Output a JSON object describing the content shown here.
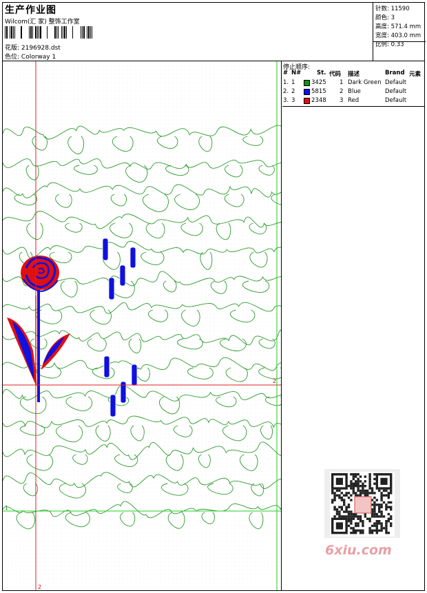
{
  "header": {
    "title": "生产作业图",
    "company": "Wilcom(汇 家) 整饰工作室",
    "design_label": "花版:",
    "design_value": "2196928.dst",
    "colorway_label": "色位:",
    "colorway_value": "Colorway 1"
  },
  "stats": [
    {
      "label": "针数:",
      "value": "11590"
    },
    {
      "label": "颜色:",
      "value": "3"
    },
    {
      "label": "高度:",
      "value": "571.4 mm"
    },
    {
      "label": "宽度:",
      "value": "403.0 mm"
    },
    {
      "label": "比例:",
      "value": "0.33"
    }
  ],
  "stop_sequence": {
    "title": "停止顺序:",
    "columns": [
      "#",
      "N#",
      "St.",
      "代码",
      "描述",
      "Brand",
      "元素"
    ],
    "rows": [
      {
        "num": "1.",
        "n": "1",
        "color": "#1a8a1a",
        "stitches": "3425",
        "code": "1",
        "desc": "Dark Green",
        "brand": "Default"
      },
      {
        "num": "2.",
        "n": "2",
        "color": "#1010e0",
        "stitches": "5815",
        "code": "2",
        "desc": "Blue",
        "brand": "Default"
      },
      {
        "num": "3.",
        "n": "3",
        "color": "#e01010",
        "stitches": "2348",
        "code": "3",
        "desc": "Red",
        "brand": "Default"
      }
    ]
  },
  "guides": {
    "vertical_label": "2",
    "horizontal_label": "2",
    "green_label": "1"
  },
  "watermark": {
    "text": "6xiu.com"
  },
  "colors": {
    "green": "#2a9a2a",
    "blue": "#1010e0",
    "red": "#e01010",
    "guide_red": "#e02020",
    "guide_green": "#22cc22"
  }
}
